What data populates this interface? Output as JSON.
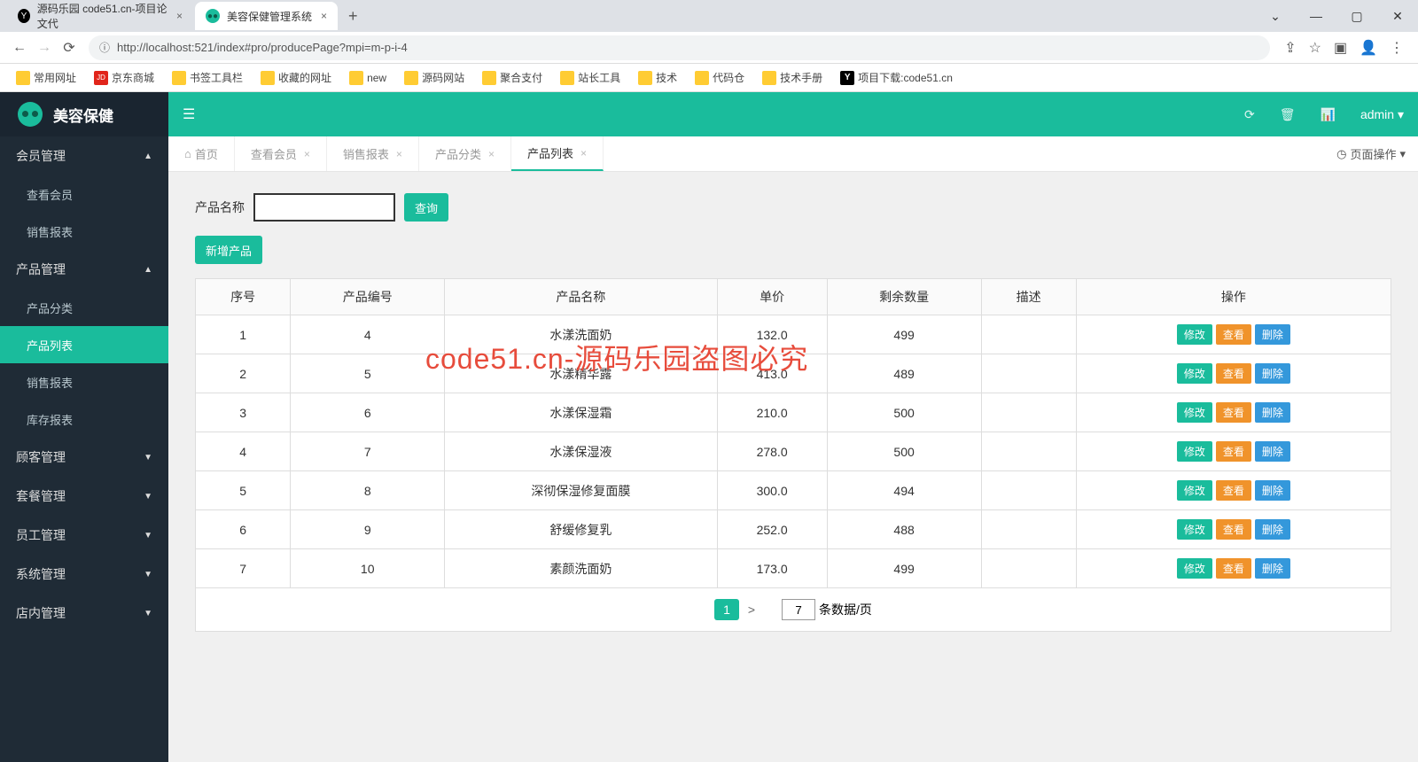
{
  "browser": {
    "tabs": [
      {
        "title": "源码乐园 code51.cn-项目论文代",
        "icon": "Y"
      },
      {
        "title": "美容保健管理系统",
        "icon": "●●"
      }
    ],
    "url": "http://localhost:521/index#pro/producePage?mpi=m-p-i-4",
    "bookmarks": [
      "常用网址",
      "京东商城",
      "书签工具栏",
      "收藏的网址",
      "new",
      "源码网站",
      "聚合支付",
      "站长工具",
      "技术",
      "代码仓",
      "技术手册",
      "项目下载:code51.cn"
    ],
    "window_controls": {
      "min": "—",
      "max": "▢",
      "close": "✕"
    },
    "drop": "⌄"
  },
  "app": {
    "logo": "美容保健",
    "user": "admin",
    "user_caret": "▾",
    "sidebar": [
      {
        "label": "会员管理",
        "open": true,
        "items": [
          "查看会员",
          "销售报表"
        ]
      },
      {
        "label": "产品管理",
        "open": true,
        "items": [
          "产品分类",
          "产品列表",
          "销售报表",
          "库存报表"
        ],
        "active": "产品列表"
      },
      {
        "label": "顾客管理",
        "open": false
      },
      {
        "label": "套餐管理",
        "open": false
      },
      {
        "label": "员工管理",
        "open": false
      },
      {
        "label": "系统管理",
        "open": false
      },
      {
        "label": "店内管理",
        "open": false
      }
    ],
    "page_tabs": [
      {
        "label": "首页",
        "icon": "⌂",
        "closable": false
      },
      {
        "label": "查看会员",
        "closable": true
      },
      {
        "label": "销售报表",
        "closable": true
      },
      {
        "label": "产品分类",
        "closable": true
      },
      {
        "label": "产品列表",
        "closable": true,
        "active": true
      }
    ],
    "page_ops": "页面操作",
    "page_ops_caret": "▾",
    "search": {
      "label": "产品名称",
      "button": "查询"
    },
    "add_button": "新增产品",
    "table": {
      "headers": [
        "序号",
        "产品编号",
        "产品名称",
        "单价",
        "剩余数量",
        "描述",
        "操作"
      ],
      "rows": [
        {
          "seq": "1",
          "code": "4",
          "name": "水漾洗面奶",
          "price": "132.0",
          "qty": "499",
          "desc": ""
        },
        {
          "seq": "2",
          "code": "5",
          "name": "水漾精华露",
          "price": "413.0",
          "qty": "489",
          "desc": ""
        },
        {
          "seq": "3",
          "code": "6",
          "name": "水漾保湿霜",
          "price": "210.0",
          "qty": "500",
          "desc": ""
        },
        {
          "seq": "4",
          "code": "7",
          "name": "水漾保湿液",
          "price": "278.0",
          "qty": "500",
          "desc": ""
        },
        {
          "seq": "5",
          "code": "8",
          "name": "深彻保湿修复面膜",
          "price": "300.0",
          "qty": "494",
          "desc": ""
        },
        {
          "seq": "6",
          "code": "9",
          "name": "舒缓修复乳",
          "price": "252.0",
          "qty": "488",
          "desc": ""
        },
        {
          "seq": "7",
          "code": "10",
          "name": "素颜洗面奶",
          "price": "173.0",
          "qty": "499",
          "desc": ""
        }
      ],
      "actions": {
        "edit": "修改",
        "view": "查看",
        "del": "删除"
      }
    },
    "pagination": {
      "current": "1",
      "next": ">",
      "page_size": "7",
      "suffix": "条数据/页"
    },
    "watermark": "code51.cn-源码乐园盗图必究"
  }
}
